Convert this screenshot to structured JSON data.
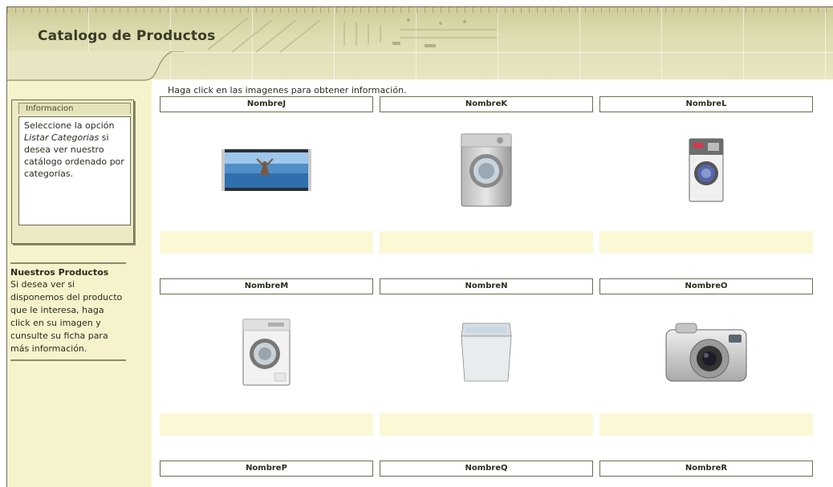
{
  "header": {
    "title": "Catalogo de Productos"
  },
  "sidebar": {
    "info_tab": "Informacion",
    "info_text_1": "Seleccione la opción ",
    "info_text_em": "Listar Categorias",
    "info_text_2": " si desea ver nuestro catálogo ordenado por categorías.",
    "productos_title": "Nuestros Productos",
    "productos_text": "Si desea ver si disponemos del producto que le interesa, haga click en su imagen y cunsulte su ficha para más información."
  },
  "main": {
    "instructions": "Haga click en las imagenes para obtener información.",
    "products": [
      {
        "name": "NombreJ",
        "icon": "tv-icon"
      },
      {
        "name": "NombreK",
        "icon": "washing-machine-icon"
      },
      {
        "name": "NombreL",
        "icon": "commercial-washer-icon"
      },
      {
        "name": "NombreM",
        "icon": "washing-machine-icon"
      },
      {
        "name": "NombreN",
        "icon": "top-load-washer-icon"
      },
      {
        "name": "NombreO",
        "icon": "camera-icon"
      },
      {
        "name": "NombreP",
        "icon": ""
      },
      {
        "name": "NombreQ",
        "icon": ""
      },
      {
        "name": "NombreR",
        "icon": ""
      }
    ]
  },
  "colors": {
    "sidebar_bg": "#f6f3cc",
    "border": "#6d6b50",
    "caption_bg": "#fbf8d6",
    "header_bg": "#dedcb0"
  }
}
